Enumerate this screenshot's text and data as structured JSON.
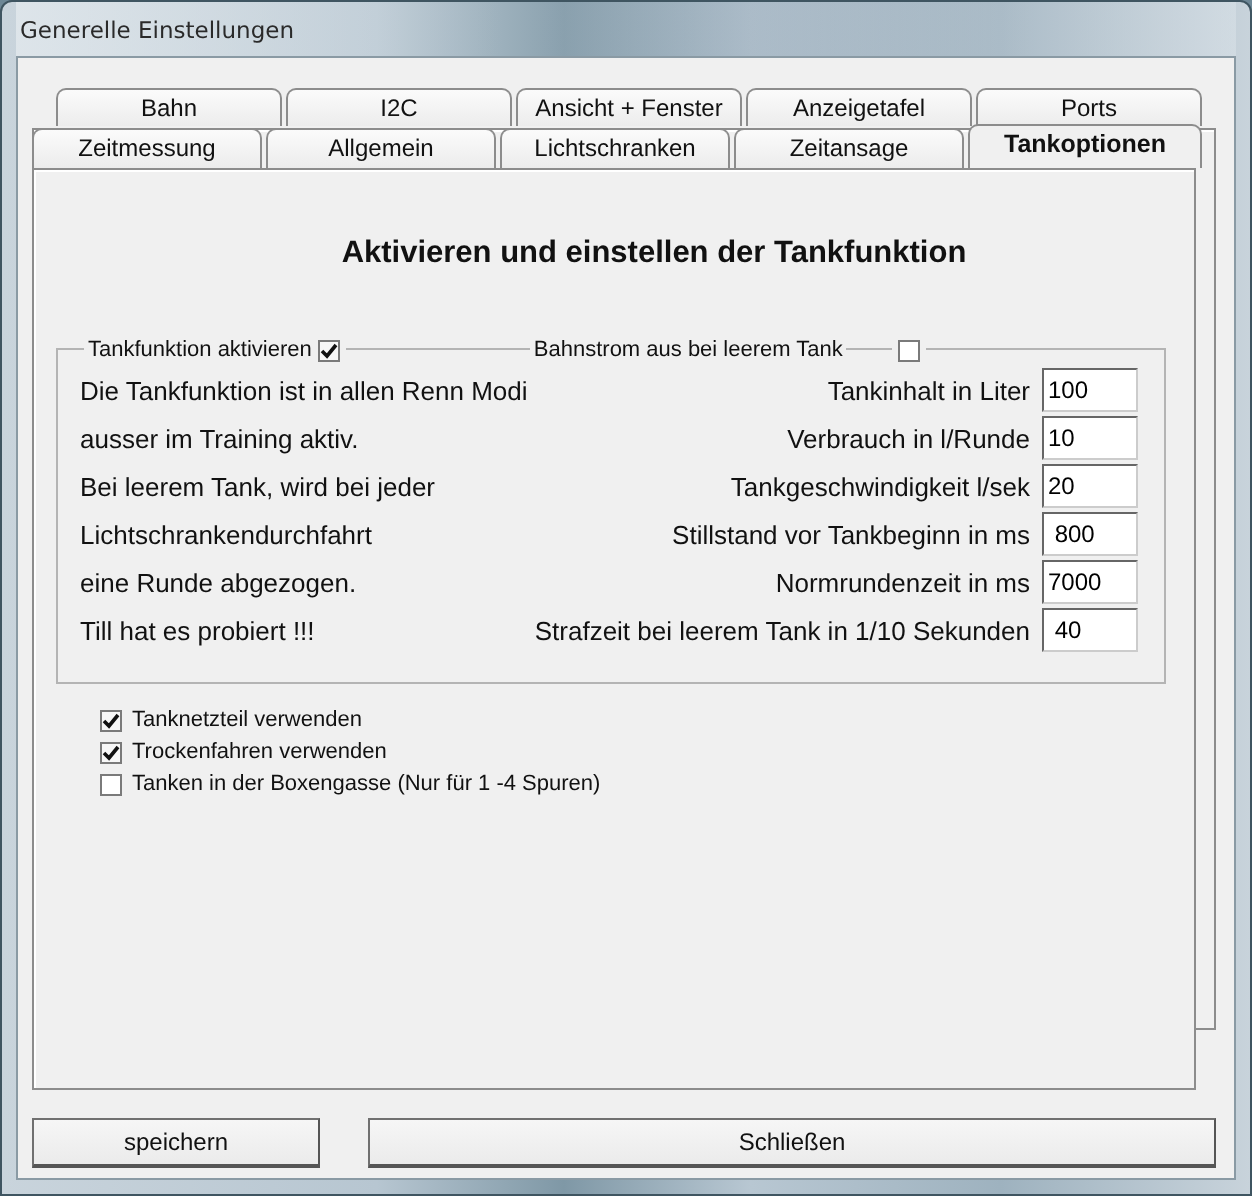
{
  "window": {
    "title": "Generelle Einstellungen"
  },
  "tabs_back": [
    {
      "label": "Bahn",
      "selected": false
    },
    {
      "label": "I2C",
      "selected": false
    },
    {
      "label": "Ansicht + Fenster",
      "selected": false
    },
    {
      "label": "Anzeigetafel",
      "selected": false
    },
    {
      "label": "Ports",
      "selected": false
    }
  ],
  "tabs_front": [
    {
      "label": "Zeitmessung",
      "selected": false
    },
    {
      "label": "Allgemein",
      "selected": false
    },
    {
      "label": "Lichtschranken",
      "selected": false
    },
    {
      "label": "Zeitansage",
      "selected": false
    },
    {
      "label": "Tankoptionen",
      "selected": true
    }
  ],
  "page": {
    "heading": "Aktivieren und einstellen der Tankfunktion",
    "enable": {
      "label": "Tankfunktion aktivieren",
      "checked": true
    },
    "power_off": {
      "label": "Bahnstrom aus bei leerem Tank",
      "checked": false
    },
    "notes": [
      "Die Tankfunktion ist in allen Renn Modi",
      "ausser im Training aktiv.",
      "Bei leerem Tank, wird bei jeder",
      "Lichtschrankendurchfahrt",
      "eine Runde abgezogen.",
      "Till hat es probiert !!!"
    ],
    "fields": [
      {
        "label": "Tankinhalt in Liter",
        "value": "100"
      },
      {
        "label": "Verbrauch in l/Runde",
        "value": "10"
      },
      {
        "label": "Tankgeschwindigkeit l/sek",
        "value": "20"
      },
      {
        "label": "Stillstand vor Tankbeginn in ms",
        "value": " 800"
      },
      {
        "label": "Normrundenzeit in ms",
        "value": "7000"
      },
      {
        "label": "Strafzeit bei leerem Tank in 1/10 Sekunden",
        "value": " 40"
      }
    ],
    "options": [
      {
        "label": "Tanknetzteil verwenden",
        "checked": true
      },
      {
        "label": "Trockenfahren verwenden",
        "checked": true
      },
      {
        "label": "Tanken in der Boxengasse (Nur für 1 -4 Spuren)",
        "checked": false
      }
    ]
  },
  "buttons": [
    {
      "label": "speichern"
    },
    {
      "label": "Schließen"
    }
  ]
}
